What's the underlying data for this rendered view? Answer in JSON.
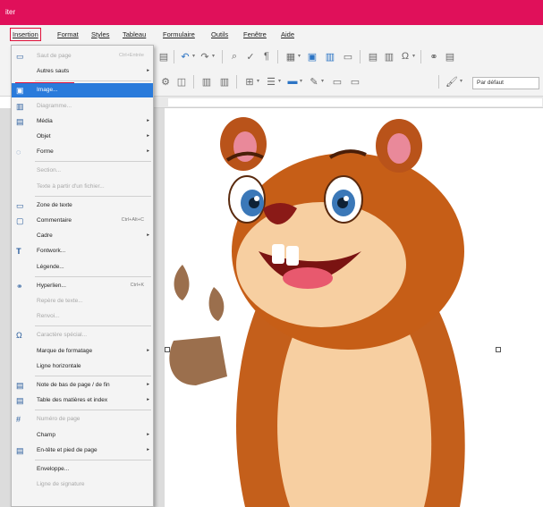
{
  "window": {
    "title": "iter"
  },
  "menubar": [
    "Insertion",
    "Format",
    "Styles",
    "Tableau",
    "Formulaire",
    "Outils",
    "Fenêtre",
    "Aide"
  ],
  "toolbar": {
    "style_select_value": "Par défaut"
  },
  "insert_menu": {
    "items": [
      {
        "label": "Saut de page",
        "shortcut": "Ctrl+Entrée",
        "disabled": true,
        "icon": "page-break-icon"
      },
      {
        "label": "Autres sauts",
        "submenu": true
      },
      {
        "label": "Image...",
        "highlighted": true,
        "icon": "image-icon"
      },
      {
        "label": "Diagramme...",
        "disabled": true,
        "icon": "chart-icon"
      },
      {
        "label": "Média",
        "submenu": true,
        "icon": "media-icon"
      },
      {
        "label": "Objet",
        "submenu": true
      },
      {
        "label": "Forme",
        "submenu": true,
        "icon": "shape-icon"
      },
      {
        "label": "Section...",
        "disabled": true
      },
      {
        "label": "Texte à partir d'un fichier...",
        "disabled": true
      },
      {
        "label": "Zone de texte",
        "icon": "text-box-icon"
      },
      {
        "label": "Commentaire",
        "shortcut": "Ctrl+Alt+C",
        "icon": "comment-icon"
      },
      {
        "label": "Cadre",
        "submenu": true
      },
      {
        "label": "Fontwork...",
        "icon": "fontwork-icon"
      },
      {
        "label": "Légende..."
      },
      {
        "label": "Hyperlien...",
        "shortcut": "Ctrl+K",
        "icon": "hyperlink-icon"
      },
      {
        "label": "Repère de texte...",
        "disabled": true
      },
      {
        "label": "Renvoi...",
        "disabled": true
      },
      {
        "label": "Caractère spécial...",
        "disabled": true,
        "icon": "special-char-icon"
      },
      {
        "label": "Marque de formatage",
        "submenu": true
      },
      {
        "label": "Ligne horizontale"
      },
      {
        "label": "Note de bas de page / de fin",
        "submenu": true,
        "icon": "footnote-icon"
      },
      {
        "label": "Table des matières et index",
        "submenu": true,
        "icon": "toc-icon"
      },
      {
        "label": "Numéro de page",
        "disabled": true,
        "icon": "page-number-icon"
      },
      {
        "label": "Champ",
        "submenu": true
      },
      {
        "label": "En-tête et pied de page",
        "submenu": true,
        "icon": "header-footer-icon"
      },
      {
        "label": "Enveloppe..."
      },
      {
        "label": "Ligne de signature",
        "disabled": true
      }
    ]
  },
  "colors": {
    "titlebar": "#e0105a",
    "highlight": "#2a7bdb",
    "annotation": "#e0103a"
  }
}
